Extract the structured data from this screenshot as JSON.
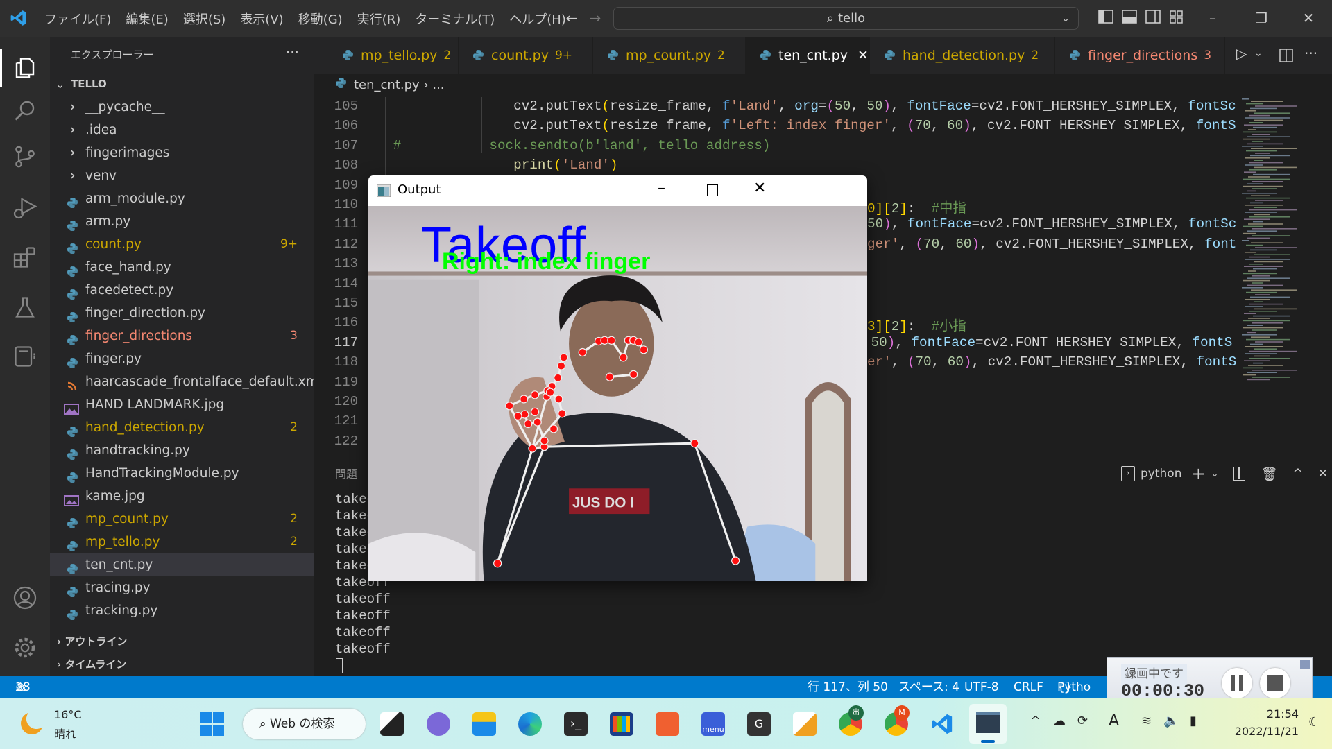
{
  "titlebar": {
    "menu": [
      "ファイル(F)",
      "編集(E)",
      "選択(S)",
      "表示(V)",
      "移動(G)",
      "実行(R)",
      "ターミナル(T)",
      "ヘルプ(H)"
    ],
    "search": "tello"
  },
  "sidebar": {
    "title": "エクスプローラー",
    "more": "···",
    "root": "TELLO",
    "items": [
      {
        "label": "__pycache__",
        "type": "folder"
      },
      {
        "label": ".idea",
        "type": "folder"
      },
      {
        "label": "fingerimages",
        "type": "folder"
      },
      {
        "label": "venv",
        "type": "folder"
      },
      {
        "label": "arm_module.py",
        "type": "py"
      },
      {
        "label": "arm.py",
        "type": "py"
      },
      {
        "label": "count.py",
        "type": "py",
        "badge": "9+",
        "status": "warning"
      },
      {
        "label": "face_hand.py",
        "type": "py"
      },
      {
        "label": "facedetect.py",
        "type": "py"
      },
      {
        "label": "finger_direction.py",
        "type": "py"
      },
      {
        "label": "finger_directions",
        "type": "py",
        "badge": "3",
        "status": "error"
      },
      {
        "label": "finger.py",
        "type": "py"
      },
      {
        "label": "haarcascade_frontalface_default.xml",
        "type": "xml"
      },
      {
        "label": "HAND LANDMARK.jpg",
        "type": "img"
      },
      {
        "label": "hand_detection.py",
        "type": "py",
        "badge": "2",
        "status": "warning"
      },
      {
        "label": "handtracking.py",
        "type": "py"
      },
      {
        "label": "HandTrackingModule.py",
        "type": "py"
      },
      {
        "label": "kame.jpg",
        "type": "img"
      },
      {
        "label": "mp_count.py",
        "type": "py",
        "badge": "2",
        "status": "warning"
      },
      {
        "label": "mp_tello.py",
        "type": "py",
        "badge": "2",
        "status": "warning"
      },
      {
        "label": "ten_cnt.py",
        "type": "py",
        "selected": true
      },
      {
        "label": "tracing.py",
        "type": "py"
      },
      {
        "label": "tracking.py",
        "type": "py"
      }
    ],
    "outline": "アウトライン",
    "timeline": "タイムライン"
  },
  "tabs": [
    {
      "label": "mp_tello.py",
      "badge": "2",
      "status": "warning"
    },
    {
      "label": "count.py",
      "badge": "9+",
      "status": "warning"
    },
    {
      "label": "mp_count.py",
      "badge": "2",
      "status": "warning"
    },
    {
      "label": "ten_cnt.py",
      "active": true
    },
    {
      "label": "hand_detection.py",
      "badge": "2",
      "status": "warning"
    },
    {
      "label": "finger_directions",
      "badge": "3",
      "status": "error"
    }
  ],
  "breadcrumb": {
    "file": "ten_cnt.py",
    "rest": "..."
  },
  "editor": {
    "current_line": 117,
    "line_numbers": [
      105,
      106,
      107,
      108,
      109,
      110,
      111,
      112,
      113,
      114,
      115,
      116,
      117,
      118,
      119,
      120,
      121,
      122
    ],
    "lines": {
      "105": [
        {
          "t": "                cv2.putText",
          "c": "def"
        },
        {
          "t": "(",
          "c": "b1"
        },
        {
          "t": "resize_frame, ",
          "c": "def"
        },
        {
          "t": "f",
          "c": "kw"
        },
        {
          "t": "'Land'",
          "c": "str"
        },
        {
          "t": ", ",
          "c": "def"
        },
        {
          "t": "org",
          "c": "par"
        },
        {
          "t": "=",
          "c": "def"
        },
        {
          "t": "(",
          "c": "b2"
        },
        {
          "t": "50",
          "c": "num"
        },
        {
          "t": ", ",
          "c": "def"
        },
        {
          "t": "50",
          "c": "num"
        },
        {
          "t": ")",
          "c": "b2"
        },
        {
          "t": ", ",
          "c": "def"
        },
        {
          "t": "fontFace",
          "c": "par"
        },
        {
          "t": "=cv2.FONT_HERSHEY_SIMPLEX, ",
          "c": "def"
        },
        {
          "t": "fontSc",
          "c": "par"
        }
      ],
      "106": [
        {
          "t": "                cv2.putText",
          "c": "def"
        },
        {
          "t": "(",
          "c": "b1"
        },
        {
          "t": "resize_frame, ",
          "c": "def"
        },
        {
          "t": "f",
          "c": "kw"
        },
        {
          "t": "'Left: index finger'",
          "c": "str"
        },
        {
          "t": ", ",
          "c": "def"
        },
        {
          "t": "(",
          "c": "b2"
        },
        {
          "t": "70",
          "c": "num"
        },
        {
          "t": ", ",
          "c": "def"
        },
        {
          "t": "60",
          "c": "num"
        },
        {
          "t": ")",
          "c": "b2"
        },
        {
          "t": ", cv2.FONT_HERSHEY_SIMPLEX, ",
          "c": "def"
        },
        {
          "t": "fontS",
          "c": "par"
        }
      ],
      "107": [
        {
          "t": " #           sock.sendto(b'land', tello_address)",
          "c": "com"
        }
      ],
      "108": [
        {
          "t": "                ",
          "c": "def"
        },
        {
          "t": "print",
          "c": "fn"
        },
        {
          "t": "(",
          "c": "b1"
        },
        {
          "t": "'Land'",
          "c": "str"
        },
        {
          "t": ")",
          "c": "b1"
        }
      ],
      "110": [
        {
          "t": "0]",
          "c": "b1"
        },
        {
          "t": "[",
          "c": "b1"
        },
        {
          "t": "2",
          "c": "num"
        },
        {
          "t": "]",
          "c": "b1"
        },
        {
          "t": ":  ",
          "c": "def"
        },
        {
          "t": "#中指",
          "c": "com"
        }
      ],
      "111": [
        {
          "t": "50",
          "c": "num"
        },
        {
          "t": ")",
          "c": "b2"
        },
        {
          "t": ", ",
          "c": "def"
        },
        {
          "t": "fontFace",
          "c": "par"
        },
        {
          "t": "=cv2.FONT_HERSHEY_SIMPLEX, ",
          "c": "def"
        },
        {
          "t": "fontSc",
          "c": "par"
        }
      ],
      "112": [
        {
          "t": "ger'",
          "c": "str"
        },
        {
          "t": ", ",
          "c": "def"
        },
        {
          "t": "(",
          "c": "b2"
        },
        {
          "t": "70",
          "c": "num"
        },
        {
          "t": ", ",
          "c": "def"
        },
        {
          "t": "60",
          "c": "num"
        },
        {
          "t": ")",
          "c": "b2"
        },
        {
          "t": ", cv2.FONT_HERSHEY_SIMPLEX, ",
          "c": "def"
        },
        {
          "t": "font",
          "c": "par"
        }
      ],
      "116": [
        {
          "t": "3]",
          "c": "b1"
        },
        {
          "t": "[",
          "c": "b1"
        },
        {
          "t": "2",
          "c": "num"
        },
        {
          "t": "]",
          "c": "b1"
        },
        {
          "t": ":  ",
          "c": "def"
        },
        {
          "t": "#小指",
          "c": "com"
        }
      ],
      "117": [
        {
          "t": " 50",
          "c": "num"
        },
        {
          "t": ")",
          "c": "b2"
        },
        {
          "t": ", ",
          "c": "def"
        },
        {
          "t": "fontFace",
          "c": "par"
        },
        {
          "t": "=cv2.FONT_HERSHEY_SIMPLEX, ",
          "c": "def"
        },
        {
          "t": "fontS",
          "c": "par"
        }
      ],
      "118": [
        {
          "t": "er'",
          "c": "str"
        },
        {
          "t": ", ",
          "c": "def"
        },
        {
          "t": "(",
          "c": "b2"
        },
        {
          "t": "70",
          "c": "num"
        },
        {
          "t": ", ",
          "c": "def"
        },
        {
          "t": "60",
          "c": "num"
        },
        {
          "t": ")",
          "c": "b2"
        },
        {
          "t": ", cv2.FONT_HERSHEY_SIMPLEX, ",
          "c": "def"
        },
        {
          "t": "fontS",
          "c": "par"
        }
      ]
    }
  },
  "panel": {
    "tab": "問題",
    "terminal_name": "python",
    "terminal_lines": [
      "takeoff",
      "takeoff",
      "takeoff",
      "takeoff",
      "takeoff",
      "takeoff",
      "takeoff",
      "takeoff",
      "takeoff",
      "takeoff"
    ]
  },
  "output_window": {
    "title": "Output",
    "overlay_main": "Takeoff",
    "overlay_sub": "Right: index finger",
    "overlay_main_color": "#0000ff",
    "overlay_sub_color": "#00ff00",
    "shirt_text": "JUS DO I"
  },
  "statusbar": {
    "errors": "1",
    "warnings": "18",
    "position": "行 117、列 50",
    "spaces": "スペース: 4",
    "encoding": "UTF-8",
    "eol": "CRLF",
    "language": "Pytho",
    "color": "#007acc"
  },
  "recording": {
    "label": "録画中です",
    "time": "00:00:30"
  },
  "taskbar": {
    "temp": "16°C",
    "weather": "晴れ",
    "search": "Web の検索",
    "time": "21:54",
    "date": "2022/11/21",
    "apps": [
      "start",
      "search",
      "task-view",
      "chat",
      "file-explorer",
      "edge",
      "terminal",
      "store",
      "mail",
      "menu-at",
      "g-app",
      "pdf-app",
      "chrome",
      "chrome-m",
      "vscode",
      "python-output"
    ],
    "badge_chrome": "出",
    "badge_chrome_m": "M",
    "menu_at_label": "menu",
    "g_label": "G"
  }
}
